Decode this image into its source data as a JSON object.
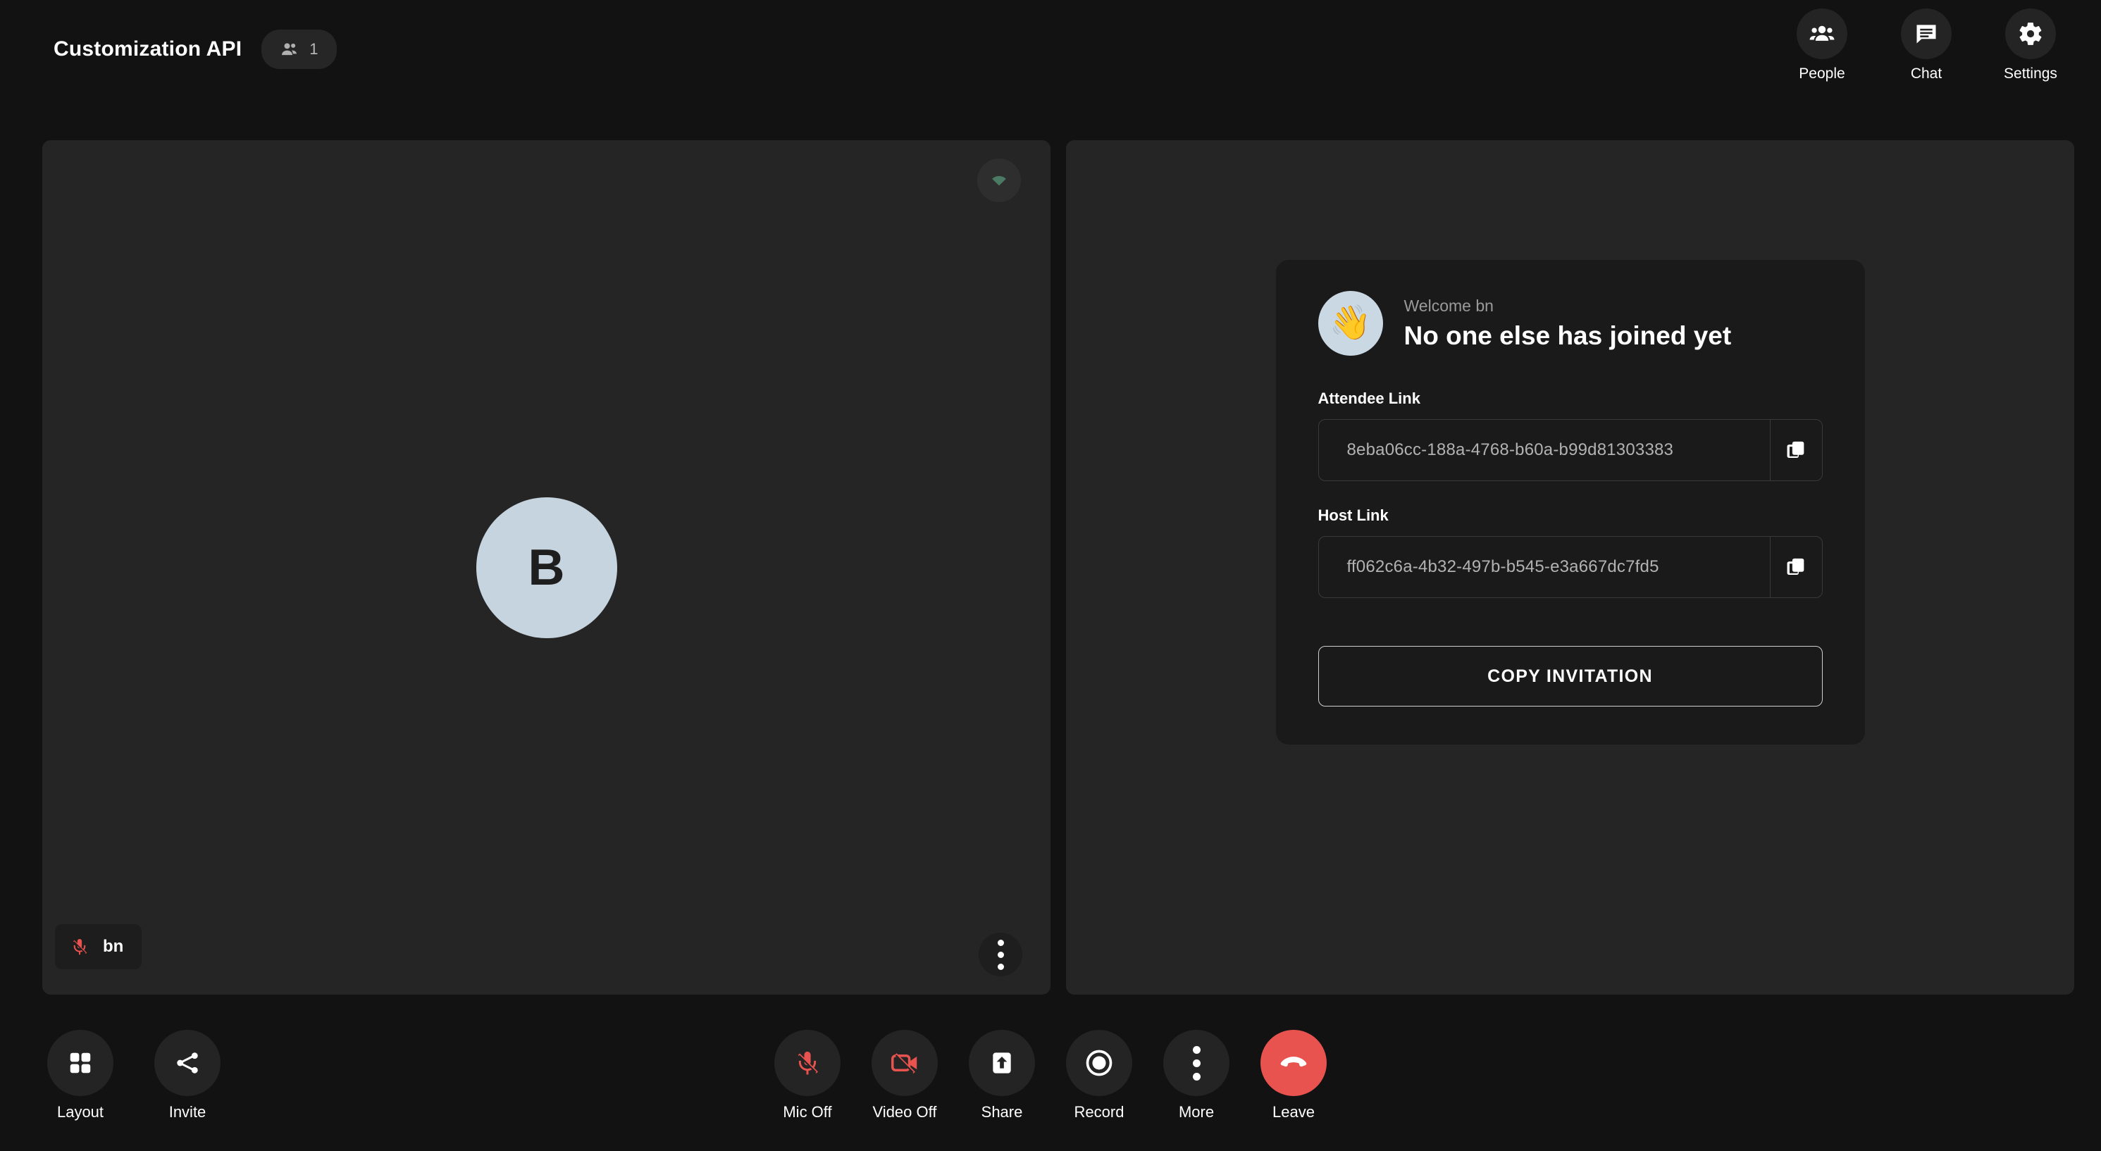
{
  "header": {
    "title": "Customization API",
    "participants_icon": "people-icon",
    "participants_count": "1",
    "actions": [
      {
        "id": "people",
        "label": "People",
        "icon": "people-group-icon"
      },
      {
        "id": "chat",
        "label": "Chat",
        "icon": "chat-bubble-icon"
      },
      {
        "id": "settings",
        "label": "Settings",
        "icon": "gear-icon"
      }
    ]
  },
  "stage": {
    "video_tile": {
      "avatar_initial": "B",
      "participant_name": "bn",
      "mic_status_icon": "mic-off-icon",
      "network_icon": "wifi-signal-icon",
      "menu_icon": "more-vertical-icon"
    },
    "invite_card": {
      "wave_emoji": "👋",
      "welcome_sub": "Welcome bn",
      "welcome_main": "No one else has joined yet",
      "attendee_label": "Attendee Link",
      "attendee_value": "8eba06cc-188a-4768-b60a-b99d81303383",
      "host_label": "Host Link",
      "host_value": "ff062c6a-4b32-497b-b545-e3a667dc7fd5",
      "copy_icon": "copy-icon",
      "copy_invitation_label": "COPY INVITATION"
    }
  },
  "bottom_bar": {
    "left_controls": [
      {
        "id": "layout",
        "label": "Layout",
        "icon": "grid-layout-icon"
      },
      {
        "id": "invite",
        "label": "Invite",
        "icon": "share-icon"
      }
    ],
    "center_controls": [
      {
        "id": "mic",
        "label": "Mic Off",
        "icon": "mic-off-icon"
      },
      {
        "id": "video",
        "label": "Video Off",
        "icon": "video-off-icon"
      },
      {
        "id": "share",
        "label": "Share",
        "icon": "screen-share-icon"
      },
      {
        "id": "record",
        "label": "Record",
        "icon": "record-icon"
      },
      {
        "id": "more",
        "label": "More",
        "icon": "more-vertical-icon"
      },
      {
        "id": "leave",
        "label": "Leave",
        "icon": "hangup-phone-icon"
      }
    ]
  },
  "colors": {
    "page_bg": "#121212",
    "panel_bg": "#252525",
    "card_bg": "#1a1a1a",
    "control_bg": "#242424",
    "danger": "#e8534f",
    "avatar_bg": "#c5d4de",
    "network_good": "#4a7a63",
    "muted_text": "#9a9a9a"
  }
}
